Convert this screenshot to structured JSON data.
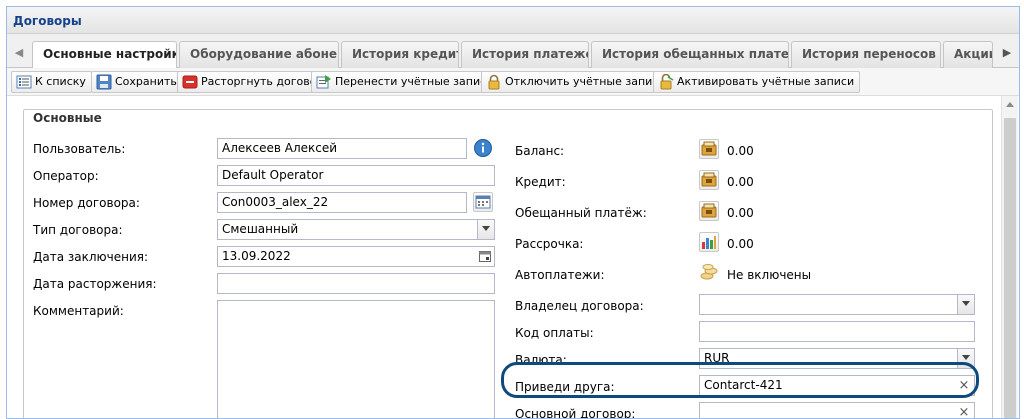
{
  "window": {
    "title": "Договоры"
  },
  "tabs": [
    {
      "label": "Основные настройки",
      "active": true
    },
    {
      "label": "Оборудование абонента"
    },
    {
      "label": "История кредита"
    },
    {
      "label": "История платежей"
    },
    {
      "label": "История обещанных платежей"
    },
    {
      "label": "История переносов УЗ"
    },
    {
      "label": "Акции"
    }
  ],
  "toolbar": {
    "back": "К списку",
    "save": "Сохранить",
    "terminate": "Расторгнуть договор",
    "transfer": "Перенести учётные записи",
    "disable": "Отключить учётные записи",
    "activate": "Активировать учётные записи"
  },
  "section": {
    "title": "Основные"
  },
  "form_left": {
    "user": {
      "label": "Пользователь:",
      "value": "Алексеев Алексей"
    },
    "operator": {
      "label": "Оператор:",
      "value": "Default Operator"
    },
    "contract_number": {
      "label": "Номер договора:",
      "value": "Con0003_alex_22"
    },
    "contract_type": {
      "label": "Тип договора:",
      "value": "Смешанный"
    },
    "date_signed": {
      "label": "Дата заключения:",
      "value": "13.09.2022"
    },
    "date_terminated": {
      "label": "Дата расторжения:",
      "value": ""
    },
    "comment": {
      "label": "Комментарий:",
      "value": ""
    }
  },
  "form_right": {
    "balance": {
      "label": "Баланс:",
      "value": "0.00"
    },
    "credit": {
      "label": "Кредит:",
      "value": "0.00"
    },
    "promised_payment": {
      "label": "Обещанный платёж:",
      "value": "0.00"
    },
    "installment": {
      "label": "Рассрочка:",
      "value": "0.00"
    },
    "autopay": {
      "label": "Автоплатежи:",
      "value": "Не включены"
    },
    "owner": {
      "label": "Владелец договора:",
      "value": ""
    },
    "payment_code": {
      "label": "Код оплаты:",
      "value": ""
    },
    "currency": {
      "label": "Валюта:",
      "value": "RUR"
    },
    "refer_friend": {
      "label": "Приведи друга:",
      "value": "Contarct-421"
    },
    "main_contract": {
      "label": "Основной договор:",
      "value": ""
    }
  },
  "colors": {
    "accent": "#15428b",
    "highlight_ring": "#0e4a7c",
    "terminate_red": "#d9302c",
    "lock_yellow": "#e8b93a"
  }
}
